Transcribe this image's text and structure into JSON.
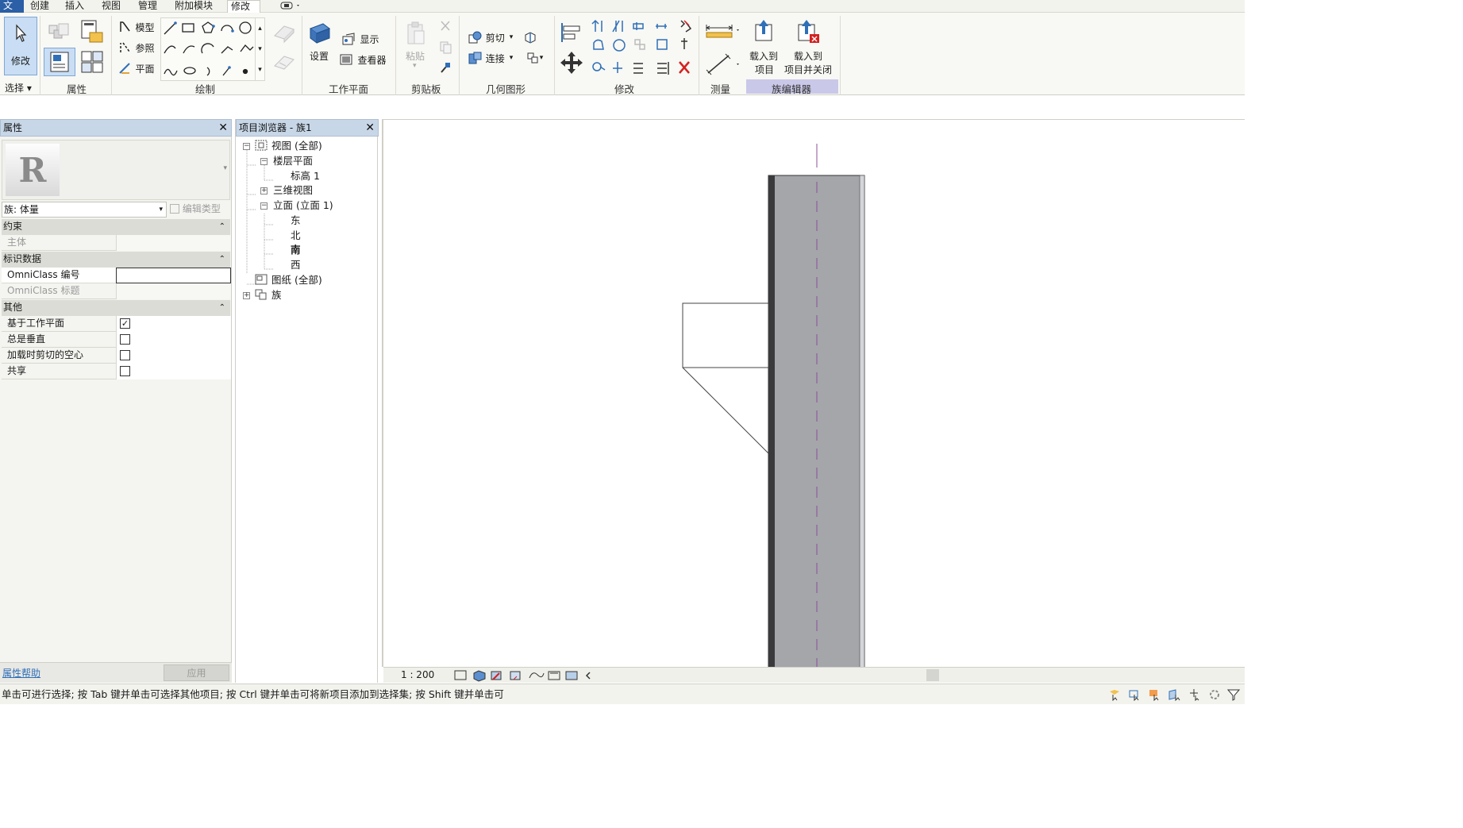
{
  "menu": {
    "items": [
      "文件",
      "创建",
      "插入",
      "视图",
      "管理",
      "附加模块",
      "修改"
    ],
    "active": "修改"
  },
  "ribbon": {
    "modify_button": "修改",
    "select_label": "选择",
    "properties_label": "属性",
    "draw": {
      "model": "模型",
      "reference": "参照",
      "plane": "平面",
      "title": "绘制"
    },
    "workplane": {
      "set": "设置",
      "show": "显示",
      "viewer": "查看器",
      "title": "工作平面"
    },
    "clipboard": {
      "paste": "粘贴",
      "title": "剪贴板"
    },
    "geometry": {
      "cut": "剪切",
      "join": "连接",
      "title": "几何图形"
    },
    "modify_title": "修改",
    "measure_title": "测量",
    "family_editor": {
      "load_to_project_1": "载入到",
      "load_to_project_2": "项目",
      "load_close_1": "载入到",
      "load_close_2": "项目并关闭",
      "title": "族编辑器"
    }
  },
  "properties": {
    "title": "属性",
    "family_selector": "族: 体量",
    "edit_type": "编辑类型",
    "sections": [
      {
        "title": "约束",
        "rows": [
          {
            "key": "主体",
            "value": "",
            "type": "text",
            "disabled": true
          }
        ]
      },
      {
        "title": "标识数据",
        "rows": [
          {
            "key": "OmniClass 编号",
            "value": "",
            "type": "input",
            "disabled": false
          },
          {
            "key": "OmniClass 标题",
            "value": "",
            "type": "text",
            "disabled": true
          }
        ]
      },
      {
        "title": "其他",
        "rows": [
          {
            "key": "基于工作平面",
            "checked": true,
            "type": "checkbox"
          },
          {
            "key": "总是垂直",
            "checked": false,
            "type": "checkbox"
          },
          {
            "key": "加载时剪切的空心",
            "checked": false,
            "type": "checkbox"
          },
          {
            "key": "共享",
            "checked": false,
            "type": "checkbox"
          }
        ]
      }
    ],
    "help_link": "属性帮助",
    "apply_button": "应用"
  },
  "browser": {
    "title": "项目浏览器 - 族1",
    "tree": {
      "views": "视图 (全部)",
      "floor_plans": "楼层平面",
      "level1": "标高 1",
      "views_3d": "三维视图",
      "elevations": "立面 (立面 1)",
      "east": "东",
      "north": "北",
      "south": "南",
      "west": "西",
      "sheets": "图纸 (全部)",
      "families": "族"
    }
  },
  "viewbar": {
    "scale": "1 : 200"
  },
  "status": {
    "text": "单击可进行选择; 按 Tab 键并单击可选择其他项目; 按 Ctrl 键并单击可将新项目添加到选择集; 按 Shift 键并单击可"
  },
  "colors": {
    "accent": "#2f6fb8",
    "wall_fill": "#a4a6aa",
    "ref_line": "#8c4f9c",
    "panel_header": "#c8d7e8"
  }
}
